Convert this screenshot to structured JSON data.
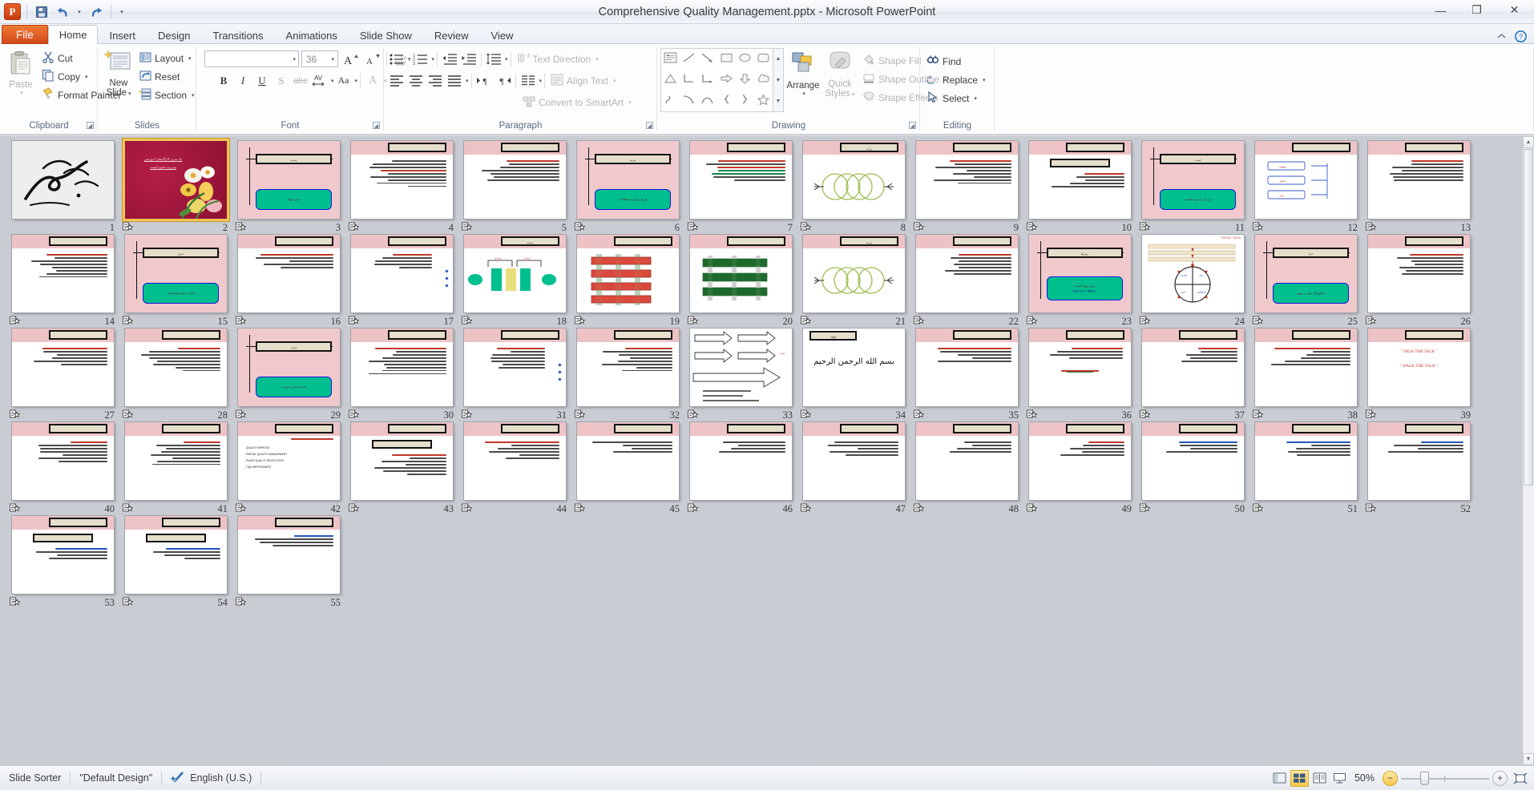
{
  "window": {
    "title": "Comprehensive Quality Management.pptx  -  Microsoft PowerPoint",
    "minimize": "—",
    "restore": "❐",
    "close": "✕"
  },
  "qat": {
    "app_logo": "P",
    "items": [
      {
        "name": "save-icon",
        "glyph": "save"
      },
      {
        "name": "undo-icon",
        "glyph": "undo"
      },
      {
        "name": "undo-dropdown-icon",
        "glyph": "▾"
      },
      {
        "name": "redo-icon",
        "glyph": "redo"
      },
      {
        "name": "customize-qat-icon",
        "glyph": "▾"
      }
    ]
  },
  "tabs": [
    {
      "label": "File",
      "kind": "file"
    },
    {
      "label": "Home",
      "kind": "active"
    },
    {
      "label": "Insert",
      "kind": "normal"
    },
    {
      "label": "Design",
      "kind": "normal"
    },
    {
      "label": "Transitions",
      "kind": "normal"
    },
    {
      "label": "Animations",
      "kind": "normal"
    },
    {
      "label": "Slide Show",
      "kind": "normal"
    },
    {
      "label": "Review",
      "kind": "normal"
    },
    {
      "label": "View",
      "kind": "normal"
    }
  ],
  "ribbon": {
    "clipboard": {
      "label": "Clipboard",
      "paste": "Paste",
      "cut": "Cut",
      "copy": "Copy",
      "format_painter": "Format Painter"
    },
    "slides": {
      "label": "Slides",
      "new_slide": "New\nSlide",
      "new_slide_line1": "New",
      "new_slide_line2": "Slide",
      "layout": "Layout",
      "reset": "Reset",
      "section": "Section"
    },
    "font": {
      "label": "Font",
      "font_name": "",
      "font_size": "36",
      "bold": "B",
      "italic": "I",
      "underline": "U",
      "shadow": "S",
      "strikethrough": "abc",
      "spacing": "AV",
      "change_case": "Aa",
      "font_color": "A",
      "grow": "A",
      "shrink": "A",
      "clear_formatting": "Aa"
    },
    "paragraph": {
      "label": "Paragraph",
      "text_direction": "Text Direction",
      "align_text": "Align Text",
      "convert_smartart": "Convert to SmartArt"
    },
    "drawing": {
      "label": "Drawing",
      "arrange": "Arrange",
      "quick_styles_l1": "Quick",
      "quick_styles_l2": "Styles",
      "shape_fill": "Shape Fill",
      "shape_outline": "Shape Outline",
      "shape_effects": "Shape Effects"
    },
    "editing": {
      "label": "Editing",
      "find": "Find",
      "replace": "Replace",
      "select": "Select"
    }
  },
  "status": {
    "view_name": "Slide Sorter",
    "theme": "\"Default Design\"",
    "language": "English (U.S.)",
    "zoom": "50%",
    "zoom_out": "−",
    "zoom_in": "+",
    "views": [
      {
        "name": "normal-view-button",
        "active": false
      },
      {
        "name": "slide-sorter-view-button",
        "active": true
      },
      {
        "name": "reading-view-button",
        "active": false
      },
      {
        "name": "slide-show-button",
        "active": false
      }
    ]
  },
  "slides": [
    {
      "n": 1,
      "type": "calligraphy",
      "transition": false
    },
    {
      "n": 2,
      "type": "cover",
      "transition": true,
      "selected": true,
      "t1": "یک سری کارگاه‌های آموزشی",
      "t2": "مدیریت جامع کیفیت"
    },
    {
      "n": 3,
      "type": "section",
      "transition": true,
      "title": "مقدمه",
      "green": "مبانی اولیه"
    },
    {
      "n": 4,
      "type": "content",
      "transition": true,
      "rows": "kkk-rkkkkk"
    },
    {
      "n": 5,
      "type": "content",
      "transition": true,
      "rows": "rkkkkkk"
    },
    {
      "n": 6,
      "type": "section",
      "transition": true,
      "title": "تعریف",
      "green": "تعریف واژه و اصطلاحات"
    },
    {
      "n": 7,
      "type": "content",
      "transition": true,
      "rows": "rk-rggkk"
    },
    {
      "n": 8,
      "type": "rings",
      "transition": true,
      "title": "چرخه"
    },
    {
      "n": 9,
      "type": "content",
      "transition": true,
      "rows": "rkkkkkkk"
    },
    {
      "n": 10,
      "type": "content-box",
      "transition": true,
      "rows": "rkkkk"
    },
    {
      "n": 11,
      "type": "section",
      "transition": true,
      "title": "کیفیت",
      "green": "دو رکن مدیریت کیفیت"
    },
    {
      "n": 12,
      "type": "flow",
      "transition": true
    },
    {
      "n": 13,
      "type": "content",
      "transition": true,
      "rows": "rkkkkkk"
    },
    {
      "n": 14,
      "type": "content",
      "transition": true,
      "rows": "rkkkkkkk"
    },
    {
      "n": 15,
      "type": "section",
      "transition": true,
      "title": "اصول",
      "green": "کیفیت جامع مانع کیفیت"
    },
    {
      "n": 16,
      "type": "content",
      "transition": true,
      "rows": "rkkkk"
    },
    {
      "n": 17,
      "type": "content-dots",
      "transition": true,
      "rows": "rkkkk"
    },
    {
      "n": 18,
      "type": "process",
      "transition": true
    },
    {
      "n": 19,
      "type": "bars-red",
      "transition": true
    },
    {
      "n": 20,
      "type": "bars-green",
      "transition": true
    },
    {
      "n": 21,
      "type": "rings",
      "transition": true,
      "title": "چرخه"
    },
    {
      "n": 22,
      "type": "content",
      "transition": true,
      "rows": "rkkkkkk"
    },
    {
      "n": 23,
      "type": "section-focus",
      "transition": true,
      "title": "روش‌ها",
      "green": "روش بهبود کیفیت",
      "green2": "FOCUS - PDCA"
    },
    {
      "n": 24,
      "type": "pdca-wheel",
      "transition": true
    },
    {
      "n": 25,
      "type": "section",
      "transition": true,
      "title": "اجرا",
      "green": "فاکتورهای موثر بر بهبود"
    },
    {
      "n": 26,
      "type": "content",
      "transition": true,
      "rows": "rkkkkkk"
    },
    {
      "n": 27,
      "type": "content",
      "transition": true,
      "rows": "rkkkkk"
    },
    {
      "n": 28,
      "type": "content",
      "transition": true,
      "rows": "rkkkkkkk"
    },
    {
      "n": 29,
      "type": "section",
      "transition": true,
      "title": "فرآیند",
      "green": "فرآیند اصلی مدیریت"
    },
    {
      "n": 30,
      "type": "content",
      "transition": true,
      "rows": "rkkkkkkkk"
    },
    {
      "n": 31,
      "type": "content-dots",
      "transition": true,
      "rows": "rkkkkkk"
    },
    {
      "n": 32,
      "type": "content",
      "transition": true,
      "rows": "rkkkkkkk"
    },
    {
      "n": 33,
      "type": "arrows",
      "transition": true
    },
    {
      "n": 34,
      "type": "bismillah",
      "transition": true,
      "title": "TQM",
      "big": "بسم الله الرحمن الرحیم"
    },
    {
      "n": 35,
      "type": "content",
      "transition": true,
      "rows": "rkkkk"
    },
    {
      "n": 36,
      "type": "content-mix",
      "transition": true,
      "rows": "rkkk"
    },
    {
      "n": 37,
      "type": "content",
      "transition": true,
      "rows": "rkkkk"
    },
    {
      "n": 38,
      "type": "content",
      "transition": true,
      "rows": "rkkkkk"
    },
    {
      "n": 39,
      "type": "talk-talk",
      "transition": true,
      "l1": "\" TALK THE TALK \"",
      "l2": "\" WALK THE TALK \""
    },
    {
      "n": 40,
      "type": "content",
      "transition": true,
      "rows": "rkkkkkk"
    },
    {
      "n": 41,
      "type": "content",
      "transition": true,
      "rows": "rkkkkkkk"
    },
    {
      "n": 42,
      "type": "quality-list",
      "transition": true,
      "items": [
        "- QUALITY IMPROVE.",
        "- PARTIAL QUALITY MANAGEMENT",
        "- PHASE QUALITY REVOLUTION",
        "- TQM IMPROVEMENT"
      ]
    },
    {
      "n": 43,
      "type": "content-box",
      "transition": true,
      "rows": "rkkkkkk"
    },
    {
      "n": 44,
      "type": "content",
      "transition": true,
      "rows": "rkkkkk"
    },
    {
      "n": 45,
      "type": "content",
      "transition": true,
      "rows": "kkkk"
    },
    {
      "n": 46,
      "type": "content",
      "transition": true,
      "rows": "kkkk"
    },
    {
      "n": 47,
      "type": "content",
      "transition": true,
      "rows": "kkkkk"
    },
    {
      "n": 48,
      "type": "content",
      "transition": true,
      "rows": "kkkk"
    },
    {
      "n": 49,
      "type": "content",
      "transition": true,
      "rows": "rkkkk"
    },
    {
      "n": 50,
      "type": "content",
      "transition": true,
      "rows": "bkkk"
    },
    {
      "n": 51,
      "type": "content",
      "transition": true,
      "rows": "bkkkk"
    },
    {
      "n": 52,
      "type": "content",
      "transition": true,
      "rows": "bkkk"
    },
    {
      "n": 53,
      "type": "content-box",
      "transition": true,
      "rows": "bkkk"
    },
    {
      "n": 54,
      "type": "content-box",
      "transition": true,
      "rows": "bkkk"
    },
    {
      "n": 55,
      "type": "content",
      "transition": true,
      "rows": "bkkk"
    }
  ]
}
